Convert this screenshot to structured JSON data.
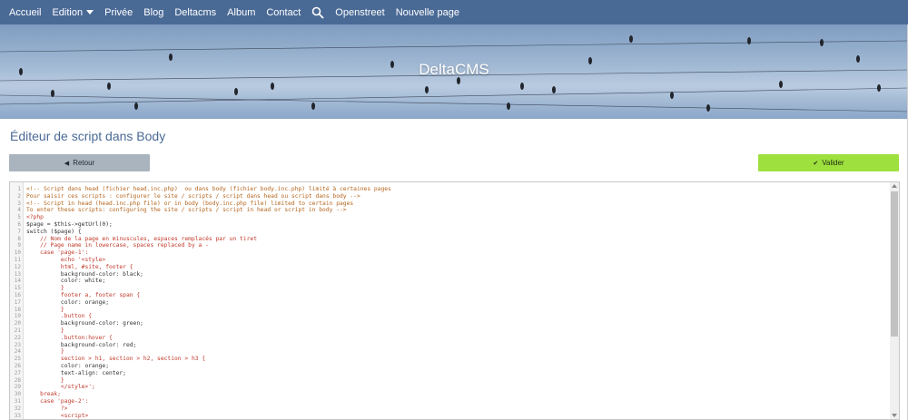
{
  "nav": {
    "items": [
      {
        "label": "Accueil",
        "dropdown": false
      },
      {
        "label": "Edition",
        "dropdown": true
      },
      {
        "label": "Privée",
        "dropdown": false
      },
      {
        "label": "Blog",
        "dropdown": false
      },
      {
        "label": "Deltacms",
        "dropdown": false
      },
      {
        "label": "Album",
        "dropdown": false
      },
      {
        "label": "Contact",
        "dropdown": false
      }
    ],
    "search_icon": "search-icon",
    "items_after_search": [
      {
        "label": "Openstreet"
      },
      {
        "label": "Nouvelle page"
      }
    ]
  },
  "banner": {
    "title": "DeltaCMS"
  },
  "page": {
    "title": "Éditeur de script dans Body"
  },
  "buttons": {
    "back": {
      "label": "Retour",
      "icon": "chevron-left-icon"
    },
    "validate": {
      "label": "Valider",
      "icon": "check-icon"
    }
  },
  "editor": {
    "lines": [
      {
        "n": "1",
        "text": "<!-- Script dans head (fichier head.inc.php)  ou dans body (fichier body.inc.php) limité à certaines pages",
        "color": "#b5651d"
      },
      {
        "n": "2",
        "text": "Pour saisir ces scripts : configurer le site / scripts / script dans head ou script dans body -->",
        "color": "#b5651d"
      },
      {
        "n": "3",
        "text": "<!-- Script in head (head.inc.php file) or in body (body.inc.php file) limited to certain pages",
        "color": "#b5651d"
      },
      {
        "n": "4",
        "text": "To enter these scripts: configuring the site / scripts / script in head or script in body -->",
        "color": "#b5651d"
      },
      {
        "n": "5",
        "text": "<?php",
        "color": "#c0392b"
      },
      {
        "n": "6",
        "text": "$page = $this->getUrl(0);",
        "color": "#333333"
      },
      {
        "n": "7",
        "text": "switch ($page) {",
        "color": "#333333"
      },
      {
        "n": "8",
        "text": "    // Nom de la page en minuscules, espaces remplacés par un tiret",
        "color": "#c0392b"
      },
      {
        "n": "9",
        "text": "    // Page name in lowercase, spaces replaced by a -",
        "color": "#c0392b"
      },
      {
        "n": "10",
        "text": "    case 'page-1':",
        "color": "#c0392b"
      },
      {
        "n": "11",
        "text": "          echo '<style>",
        "color": "#c0392b"
      },
      {
        "n": "12",
        "text": "          html, #site, footer {",
        "color": "#c0392b"
      },
      {
        "n": "13",
        "text": "          background-color: black;",
        "color": "#333333"
      },
      {
        "n": "14",
        "text": "          color: white;",
        "color": "#333333"
      },
      {
        "n": "15",
        "text": "          }",
        "color": "#c0392b"
      },
      {
        "n": "16",
        "text": "          footer a, footer span {",
        "color": "#c0392b"
      },
      {
        "n": "17",
        "text": "          color: orange;",
        "color": "#333333"
      },
      {
        "n": "18",
        "text": "          }",
        "color": "#c0392b"
      },
      {
        "n": "19",
        "text": "          .button {",
        "color": "#c0392b"
      },
      {
        "n": "20",
        "text": "          background-color: green;",
        "color": "#333333"
      },
      {
        "n": "21",
        "text": "          }",
        "color": "#c0392b"
      },
      {
        "n": "22",
        "text": "          .button:hover {",
        "color": "#c0392b"
      },
      {
        "n": "23",
        "text": "          background-color: red;",
        "color": "#333333"
      },
      {
        "n": "24",
        "text": "          }",
        "color": "#c0392b"
      },
      {
        "n": "25",
        "text": "          section > h1, section > h2, section > h3 {",
        "color": "#c0392b"
      },
      {
        "n": "26",
        "text": "          color: orange;",
        "color": "#333333"
      },
      {
        "n": "27",
        "text": "          text-align: center;",
        "color": "#333333"
      },
      {
        "n": "28",
        "text": "          }",
        "color": "#c0392b"
      },
      {
        "n": "29",
        "text": "          </style>';",
        "color": "#c0392b"
      },
      {
        "n": "30",
        "text": "    break;",
        "color": "#c0392b"
      },
      {
        "n": "31",
        "text": "    case 'page-2':",
        "color": "#c0392b"
      },
      {
        "n": "32",
        "text": "          ?>",
        "color": "#c0392b"
      },
      {
        "n": "33",
        "text": "          <script>",
        "color": "#c0392b"
      }
    ]
  }
}
